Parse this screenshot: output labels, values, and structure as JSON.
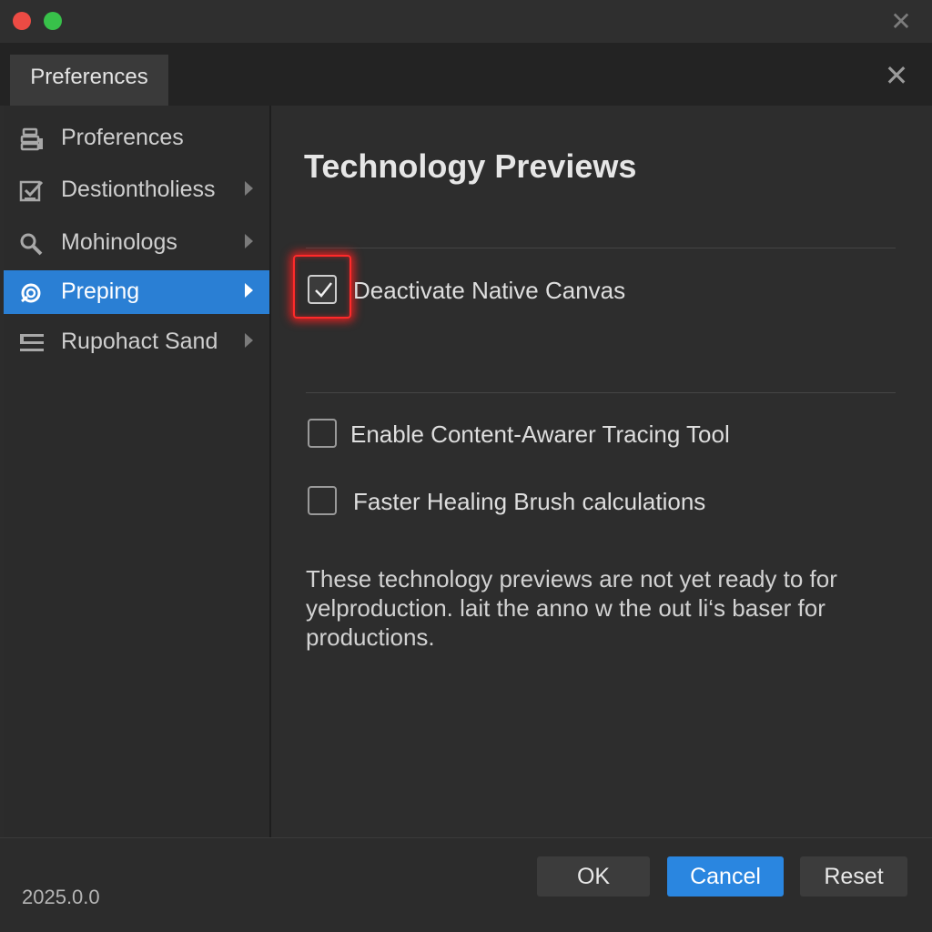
{
  "window": {
    "close_glyph": "✕"
  },
  "tab": {
    "label": "Preferences"
  },
  "dialog": {
    "close_glyph": "✕"
  },
  "sidebar": {
    "items": [
      {
        "label": "Proferences",
        "icon": "preferences-icon",
        "active": false,
        "has_chevron": false
      },
      {
        "label": "Destiontholiess",
        "icon": "checklist-icon",
        "active": false,
        "has_chevron": true
      },
      {
        "label": "Mohinologs",
        "icon": "search-icon",
        "active": false,
        "has_chevron": true
      },
      {
        "label": "Preping",
        "icon": "refresh-icon",
        "active": true,
        "has_chevron": true
      },
      {
        "label": "Rupohact Sand",
        "icon": "list-icon",
        "active": false,
        "has_chevron": true
      }
    ]
  },
  "content": {
    "heading": "Technology Previews",
    "options": [
      {
        "label": "Deactivate Native Canvas",
        "checked": true,
        "highlighted": true
      },
      {
        "label": "Enable Content-Awarer Tracing Tool",
        "checked": false
      },
      {
        "label": "Faster Healing Brush calculations",
        "checked": false
      }
    ],
    "description_lines": [
      "These technology previews are not yet ready to for",
      "yelproduction. lait the anno w the out li‘s baser for",
      "productions."
    ]
  },
  "footer": {
    "version": "2025.0.0",
    "ok_label": "OK",
    "cancel_label": "Cancel",
    "reset_label": "Reset"
  },
  "colors": {
    "accent": "#2a86e0",
    "highlight_outline": "#ff2a2a",
    "traffic_red": "#ec4b44",
    "traffic_green": "#38c14a"
  }
}
